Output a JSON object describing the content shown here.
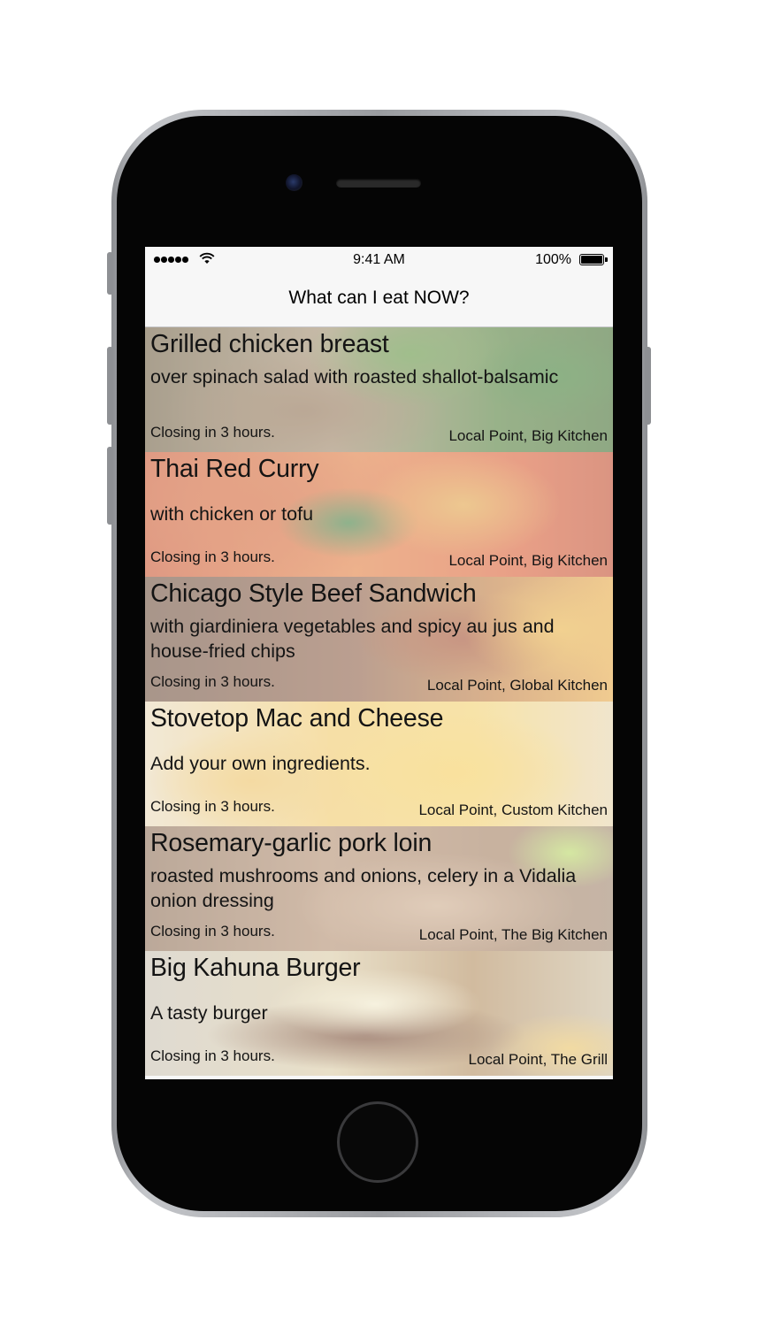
{
  "status_bar": {
    "time": "9:41 AM",
    "battery": "100%",
    "signal_icon": "signal-dots-icon",
    "wifi_icon": "wifi-icon",
    "battery_icon": "battery-icon"
  },
  "nav": {
    "title": "What can I eat NOW?"
  },
  "items": [
    {
      "title": "Grilled chicken breast",
      "description": "over spinach salad with roasted shallot-balsamic",
      "closing": "Closing in 3 hours.",
      "location": "Local Point, Big Kitchen"
    },
    {
      "title": "Thai Red Curry",
      "description": "with chicken or tofu",
      "closing": "Closing in 3 hours.",
      "location": "Local Point, Big Kitchen"
    },
    {
      "title": "Chicago Style Beef Sandwich",
      "description": "with giardiniera vegetables and spicy au jus and house-fried chips",
      "closing": "Closing in 3 hours.",
      "location": "Local Point, Global Kitchen"
    },
    {
      "title": "Stovetop Mac and Cheese",
      "description": "Add your own ingredients.",
      "closing": "Closing in 3 hours.",
      "location": "Local Point, Custom Kitchen"
    },
    {
      "title": "Rosemary-garlic pork loin",
      "description": "roasted mushrooms and onions, celery in a Vidalia onion dressing",
      "closing": "Closing in 3 hours.",
      "location": "Local Point, The Big Kitchen"
    },
    {
      "title": "Big Kahuna Burger",
      "description": "A tasty burger",
      "closing": "Closing in 3 hours.",
      "location": "Local Point, The Grill"
    }
  ]
}
